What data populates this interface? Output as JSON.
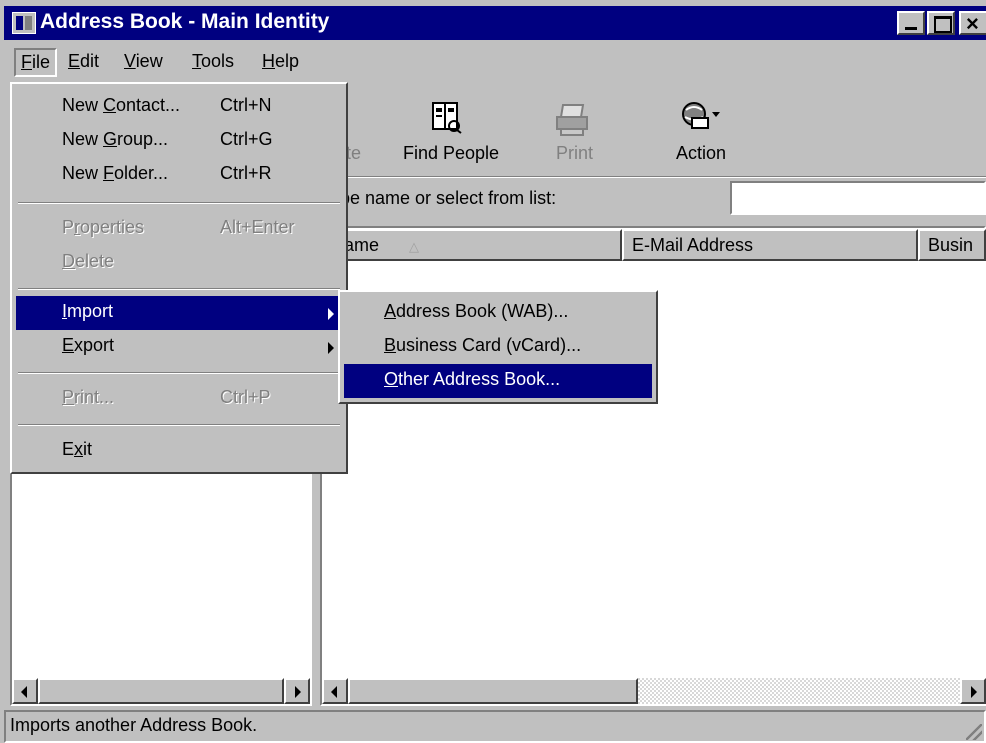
{
  "window": {
    "title": "Address Book - Main Identity"
  },
  "menubar": {
    "items": [
      {
        "label": "File",
        "mnemonic": "F",
        "rest": "ile"
      },
      {
        "label": "Edit",
        "mnemonic": "E",
        "rest": "dit"
      },
      {
        "label": "View",
        "mnemonic": "V",
        "rest": "iew"
      },
      {
        "label": "Tools",
        "mnemonic": "T",
        "rest": "ools"
      },
      {
        "label": "Help",
        "mnemonic": "H",
        "rest": "elp"
      }
    ]
  },
  "toolbar": {
    "delete_partial": "te",
    "find_people": "Find People",
    "print": "Print",
    "action": "Action",
    "icons": [
      "find-people-icon",
      "print-icon",
      "action-icon"
    ]
  },
  "search": {
    "label_partial": "pe name or select from list:",
    "value": ""
  },
  "list": {
    "columns": [
      "ame",
      "E-Mail Address",
      "Busin"
    ],
    "sort_indicator": "△"
  },
  "file_menu": {
    "items": [
      {
        "pre": "New ",
        "mn": "C",
        "post": "ontact...",
        "accel": "Ctrl+N",
        "disabled": false
      },
      {
        "pre": "New ",
        "mn": "G",
        "post": "roup...",
        "accel": "Ctrl+G",
        "disabled": false
      },
      {
        "pre": "New ",
        "mn": "F",
        "post": "older...",
        "accel": "Ctrl+R",
        "disabled": false
      },
      {
        "pre": "P",
        "mn": "r",
        "post": "operties",
        "accel": "Alt+Enter",
        "disabled": true
      },
      {
        "pre": "",
        "mn": "D",
        "post": "elete",
        "accel": "",
        "disabled": true
      },
      {
        "pre": "",
        "mn": "I",
        "post": "mport",
        "accel": "",
        "disabled": false,
        "selected": true
      },
      {
        "pre": "",
        "mn": "E",
        "post": "xport",
        "accel": "",
        "disabled": false
      },
      {
        "pre": "",
        "mn": "P",
        "post": "rint...",
        "accel": "Ctrl+P",
        "disabled": true
      },
      {
        "pre": "E",
        "mn": "x",
        "post": "it",
        "accel": "",
        "disabled": false
      }
    ]
  },
  "import_menu": {
    "items": [
      {
        "pre": "",
        "mn": "A",
        "post": "ddress Book (WAB)..."
      },
      {
        "pre": "",
        "mn": "B",
        "post": "usiness Card (vCard)..."
      },
      {
        "pre": "",
        "mn": "O",
        "post": "ther Address Book...",
        "selected": true
      }
    ]
  },
  "status": {
    "text": "Imports another Address Book."
  },
  "colors": {
    "title_bar": "#000080",
    "face": "#c0c0c0",
    "highlight": "#000080",
    "disabled_text": "#808080"
  }
}
